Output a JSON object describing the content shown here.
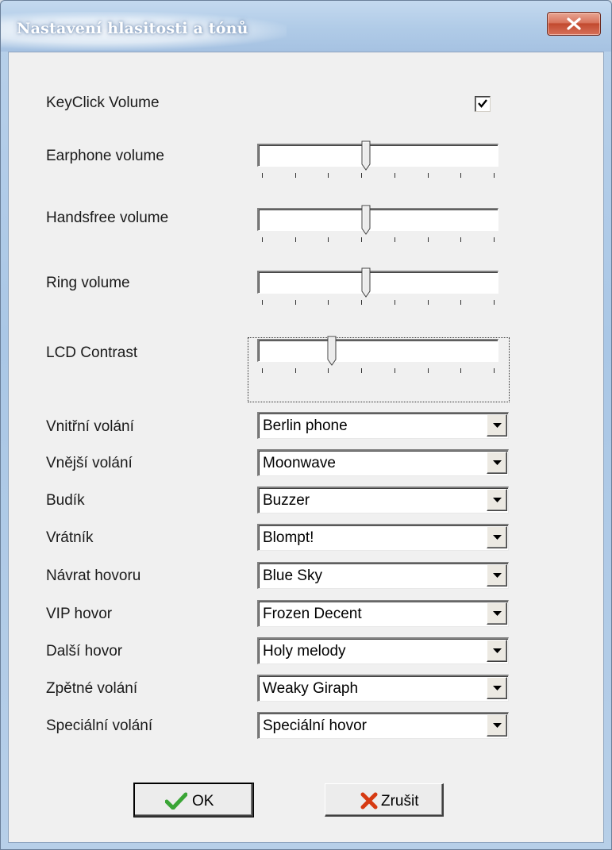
{
  "window": {
    "title": "Nastavení hlasitosti a tónů"
  },
  "keyclick": {
    "label": "KeyClick Volume",
    "checked": true
  },
  "sliders": [
    {
      "label": "Earphone volume",
      "level": 0.45
    },
    {
      "label": "Handsfree volume",
      "level": 0.45
    },
    {
      "label": "Ring volume",
      "level": 0.45
    },
    {
      "label": "LCD Contrast",
      "level": 0.3
    }
  ],
  "combos": [
    {
      "label": "Vnitřní volání",
      "value": "Berlin phone"
    },
    {
      "label": "Vnější volání",
      "value": "Moonwave"
    },
    {
      "label": "Budík",
      "value": "Buzzer"
    },
    {
      "label": "Vrátník",
      "value": "Blompt!"
    },
    {
      "label": "Návrat hovoru",
      "value": "Blue Sky"
    },
    {
      "label": "VIP hovor",
      "value": "Frozen Decent"
    },
    {
      "label": "Další hovor",
      "value": "Holy melody"
    },
    {
      "label": "Zpětné volání",
      "value": "Weaky Giraph"
    },
    {
      "label": "Speciální volání",
      "value": "Speciální hovor"
    }
  ],
  "buttons": {
    "ok": "OK",
    "cancel": "Zrušit"
  },
  "colors": {
    "ok_icon": "#3aa536",
    "cancel_icon": "#d63a12",
    "close_button": "#c24a2f"
  },
  "icons": {
    "close": "close-x",
    "ok": "checkmark",
    "cancel": "red-x",
    "checkbox": "checkmark"
  }
}
